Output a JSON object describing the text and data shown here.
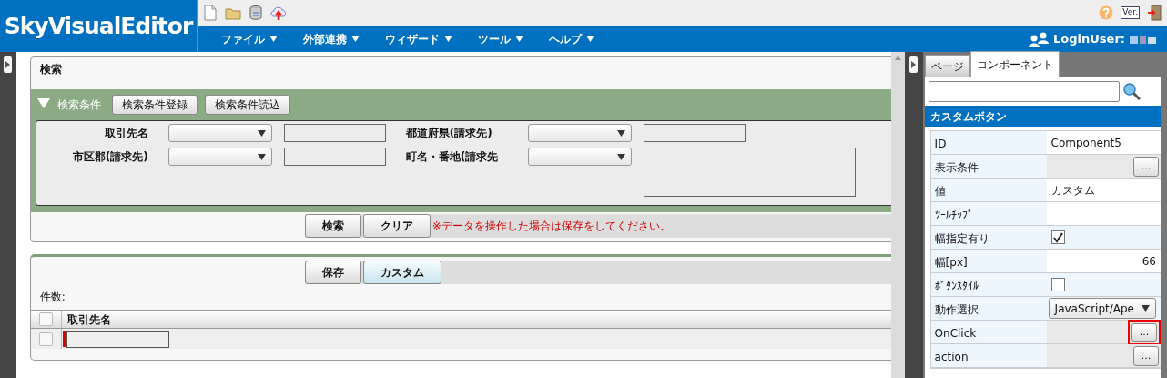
{
  "app": {
    "logo": "SkyVisualEditor",
    "version_label": "Ver.",
    "login_label": "LoginUser:",
    "menu": [
      {
        "label": "ファイル"
      },
      {
        "label": "外部連携"
      },
      {
        "label": "ウィザード"
      },
      {
        "label": "ツール"
      },
      {
        "label": "ヘルプ"
      }
    ]
  },
  "search_panel": {
    "title": "検索",
    "conditions": {
      "label": "検索条件",
      "expanded": true,
      "buttons": [
        "検索条件登録",
        "検索条件読込"
      ]
    },
    "fields": [
      {
        "label": "取引先名",
        "kind": "text_input"
      },
      {
        "label": "都道府県(請求先)",
        "kind": "text_input"
      },
      {
        "label": "市区郡(請求先)",
        "kind": "text_input"
      },
      {
        "label": "町名・番地(請求先",
        "kind": "textarea"
      }
    ],
    "buttons": [
      "検索",
      "クリア"
    ],
    "notice": "※データを操作した場合は保存をしてください。"
  },
  "list_panel": {
    "buttons": [
      {
        "label": "保存",
        "selected": false
      },
      {
        "label": "カスタム",
        "selected": true
      }
    ],
    "count_label": "件数:",
    "header_checked": false,
    "columns": [
      "取引先名"
    ],
    "rows": [
      {
        "checked": false,
        "required": true
      }
    ]
  },
  "side_panel": {
    "tabs": [
      {
        "label": "ページ",
        "selected": false
      },
      {
        "label": "コンポーネント",
        "selected": true
      }
    ],
    "section_title": "カスタムボタン",
    "properties": [
      {
        "label": "ID",
        "kind": "text",
        "value": "Component5"
      },
      {
        "label": "表示条件",
        "kind": "dialog",
        "button": "...",
        "highlighted": false
      },
      {
        "label": "値",
        "kind": "text",
        "value": "カスタム"
      },
      {
        "label": "ﾂｰﾙﾁｯﾌﾟ",
        "kind": "text"
      },
      {
        "label": "幅指定有り",
        "kind": "checkbox",
        "checked": true
      },
      {
        "label": "幅[px]",
        "kind": "number",
        "value": "66"
      },
      {
        "label": "ﾎﾞﾀﾝｽﾀｲﾙ",
        "kind": "checkbox",
        "checked": false
      },
      {
        "label": "動作選択",
        "kind": "select",
        "value": "JavaScript/Ape"
      },
      {
        "label": "OnClick",
        "kind": "dialog",
        "button": "...",
        "highlighted": true
      },
      {
        "label": "action",
        "kind": "dialog",
        "button": "...",
        "highlighted": false
      }
    ]
  }
}
